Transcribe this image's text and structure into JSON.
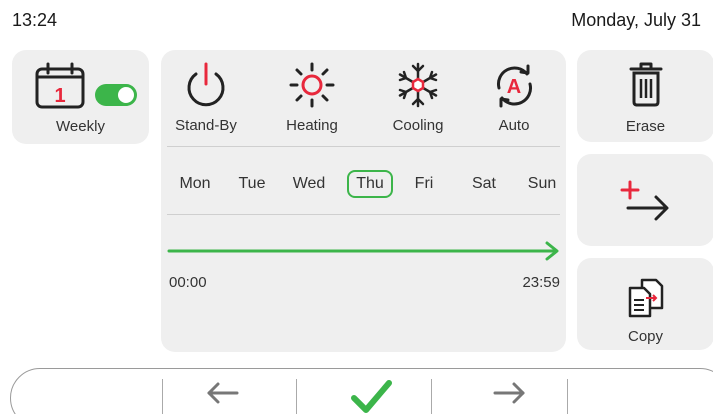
{
  "status": {
    "time": "13:24",
    "date": "Monday, July 31"
  },
  "weekly": {
    "day_number": "1",
    "label": "Weekly",
    "toggle_on": true
  },
  "modes": [
    {
      "label": "Stand-By",
      "icon": "power-icon"
    },
    {
      "label": "Heating",
      "icon": "sun-icon"
    },
    {
      "label": "Cooling",
      "icon": "snowflake-icon"
    },
    {
      "label": "Auto",
      "icon": "auto-mode-icon",
      "badge": "A"
    }
  ],
  "days": [
    "Mon",
    "Tue",
    "Wed",
    "Thu",
    "Fri",
    "Sat",
    "Sun"
  ],
  "selected_day": "Thu",
  "timeline": {
    "start": "00:00",
    "end": "23:59"
  },
  "side": {
    "erase_label": "Erase",
    "copy_label": "Copy",
    "add_icon": "add-arrow-icon"
  },
  "colors": {
    "accent_green": "#3cb54a",
    "accent_red": "#e8283c",
    "card_bg": "#efefef"
  }
}
